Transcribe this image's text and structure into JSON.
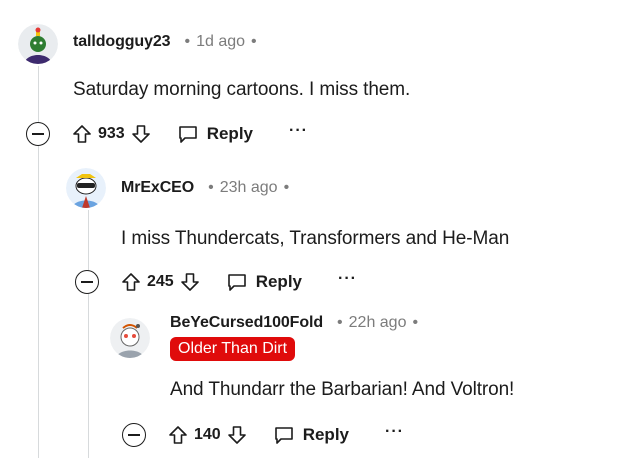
{
  "comments": [
    {
      "username": "talldogguy23",
      "time": "1d ago",
      "body": "Saturday morning cartoons. I miss them.",
      "score": "933",
      "reply_label": "Reply",
      "more_label": "···"
    },
    {
      "username": "MrExCEO",
      "time": "23h ago",
      "body": "I miss Thundercats, Transformers and He-Man",
      "score": "245",
      "reply_label": "Reply",
      "more_label": "···"
    },
    {
      "username": "BeYeCursed100Fold",
      "time": "22h ago",
      "flair": "Older Than Dirt",
      "body": "And Thundarr the Barbarian! And Voltron!",
      "score": "140",
      "reply_label": "Reply",
      "more_label": "···"
    }
  ],
  "colors": {
    "flair_bg": "#e00b0b",
    "meta_text": "#7c7c7c",
    "thread_line": "#d7dadc"
  },
  "icons": [
    "collapse-icon",
    "upvote-icon",
    "downvote-icon",
    "reply-icon",
    "more-icon"
  ]
}
